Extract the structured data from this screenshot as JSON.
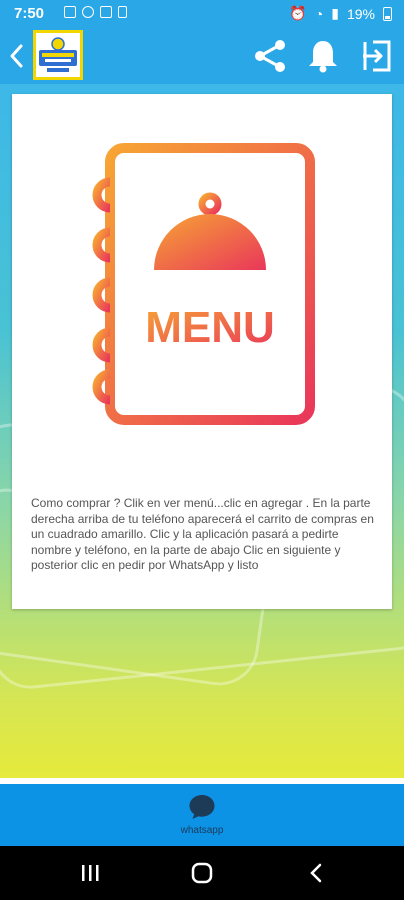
{
  "status_bar": {
    "time": "7:50",
    "battery": "19%"
  },
  "app_bar": {
    "logo_name": "app-logo",
    "actions": [
      "share-icon",
      "bell-icon",
      "exit-icon"
    ]
  },
  "card": {
    "illustration_text": "MENU",
    "instructions": "Como comprar ? Clik en ver menú...clic en agregar . En la parte derecha arriba de tu teléfono aparecerá el carrito de compras en un cuadrado amarillo. Clic  y la aplicación pasará a pedirte nombre y teléfono, en la parte de abajo Clic en siguiente y posterior clic en pedir por WhatsApp y listo"
  },
  "bottom_nav": {
    "whatsapp_label": "whatsapp"
  },
  "colors": {
    "primary": "#2aa7e6",
    "bottom_nav": "#0c93e6",
    "menu_gradient_start": "#f7a534",
    "menu_gradient_end": "#e9375a"
  }
}
